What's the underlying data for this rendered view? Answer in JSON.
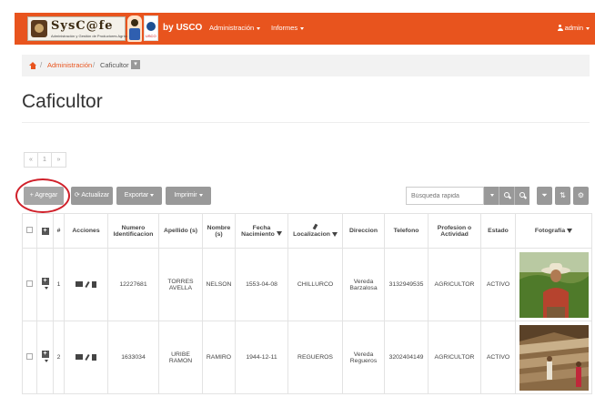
{
  "header": {
    "logo_text": "SysC@fe",
    "logo_subtitle": "Administración y Gestión de Productores Agrícolas",
    "logo_badge": "USCO",
    "brand": "by USCO",
    "nav": [
      {
        "label": "Administración"
      },
      {
        "label": "Informes"
      }
    ],
    "user": "admin"
  },
  "breadcrumb": {
    "items": [
      "Administración",
      "Caficultor"
    ]
  },
  "page": {
    "title": "Caficultor"
  },
  "pagination": {
    "first": "«",
    "current": "1",
    "last": "»"
  },
  "toolbar": {
    "agregar": "+ Agregar",
    "actualizar": "Actualizar",
    "exportar": "Exportar",
    "imprimir": "Imprimir",
    "search_placeholder": "Búsqueda rapida"
  },
  "table": {
    "headers": {
      "num": "#",
      "acciones": "Acciones",
      "numero_identificacion": "Numero Identificacion",
      "apellidos": "Apellido (s)",
      "nombres": "Nombre (s)",
      "fecha_nacimiento": "Fecha Nacimiento",
      "localizacion": "Localizacion",
      "direccion": "Direccion",
      "telefono": "Telefono",
      "profesion": "Profesion o Actividad",
      "estado": "Estado",
      "fotografia": "Fotografía"
    },
    "rows": [
      {
        "num": "1",
        "numero_identificacion": "12227681",
        "apellidos": "TORRES AVELLA",
        "nombres": "NELSON",
        "fecha_nacimiento": "1553-04-08",
        "localizacion": "CHILLURCO",
        "direccion": "Vereda Barzalosa",
        "telefono": "3132949535",
        "profesion": "AGRICULTOR",
        "estado": "ACTIVO"
      },
      {
        "num": "2",
        "numero_identificacion": "1633034",
        "apellidos": "URIBE RAMON",
        "nombres": "RAMIRO",
        "fecha_nacimiento": "1944-12-11",
        "localizacion": "REGUEROS",
        "direccion": "Vereda Regueros",
        "telefono": "3202404149",
        "profesion": "AGRICULTOR",
        "estado": "ACTIVO"
      }
    ]
  },
  "colors": {
    "brand_orange": "#e8541e",
    "button_gray": "#999999",
    "highlight_red": "#d0202a"
  }
}
